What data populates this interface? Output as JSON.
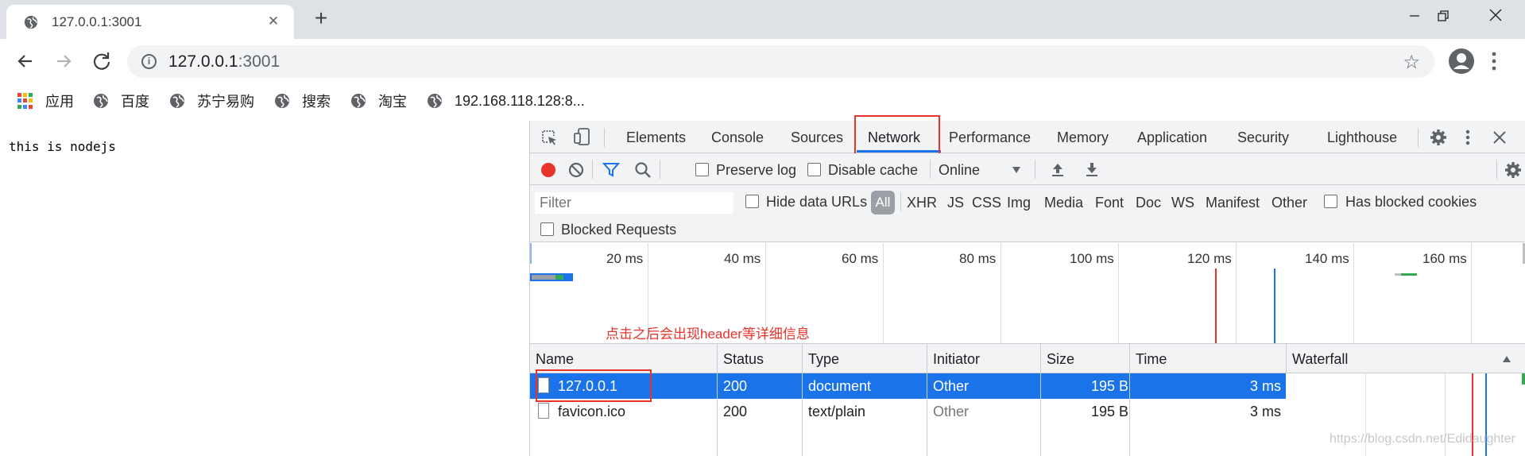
{
  "browser": {
    "tab_title": "127.0.0.1:3001",
    "url_host": "127.0.0.1",
    "url_port": ":3001"
  },
  "bookmarks": [
    {
      "label": "应用",
      "icon": "apps-grid-icon"
    },
    {
      "label": "百度",
      "icon": "globe-icon"
    },
    {
      "label": "苏宁易购",
      "icon": "globe-icon"
    },
    {
      "label": "搜索",
      "icon": "globe-icon"
    },
    {
      "label": "淘宝",
      "icon": "globe-icon"
    },
    {
      "label": "192.168.118.128:8...",
      "icon": "globe-icon"
    }
  ],
  "page": {
    "body_text": "this is nodejs"
  },
  "devtools": {
    "tabs": [
      "Elements",
      "Console",
      "Sources",
      "Network",
      "Performance",
      "Memory",
      "Application",
      "Security",
      "Lighthouse"
    ],
    "active_tab": "Network",
    "toolbar": {
      "preserve_log": "Preserve log",
      "disable_cache": "Disable cache",
      "throttle": "Online"
    },
    "filter": {
      "placeholder": "Filter",
      "hide_data_urls": "Hide data URLs",
      "all": "All",
      "types": [
        "XHR",
        "JS",
        "CSS",
        "Img",
        "Media",
        "Font",
        "Doc",
        "WS",
        "Manifest",
        "Other"
      ],
      "has_blocked_cookies": "Has blocked cookies",
      "blocked_requests": "Blocked Requests"
    },
    "overview_ticks": [
      "20 ms",
      "40 ms",
      "60 ms",
      "80 ms",
      "100 ms",
      "120 ms",
      "140 ms",
      "160 ms"
    ],
    "annotation": "点击之后会出现header等详细信息",
    "columns": [
      "Name",
      "Status",
      "Type",
      "Initiator",
      "Size",
      "Time",
      "Waterfall"
    ],
    "rows": [
      {
        "name": "127.0.0.1",
        "status": "200",
        "type": "document",
        "initiator": "Other",
        "size": "195 B",
        "time": "3 ms"
      },
      {
        "name": "favicon.ico",
        "status": "200",
        "type": "text/plain",
        "initiator": "Other",
        "size": "195 B",
        "time": "3 ms"
      }
    ]
  },
  "watermark": "https://blog.csdn.net/Edidaughter",
  "colors": {
    "accent": "#1a73e8",
    "record": "#e8332a",
    "highlight_box": "#e8332a"
  }
}
